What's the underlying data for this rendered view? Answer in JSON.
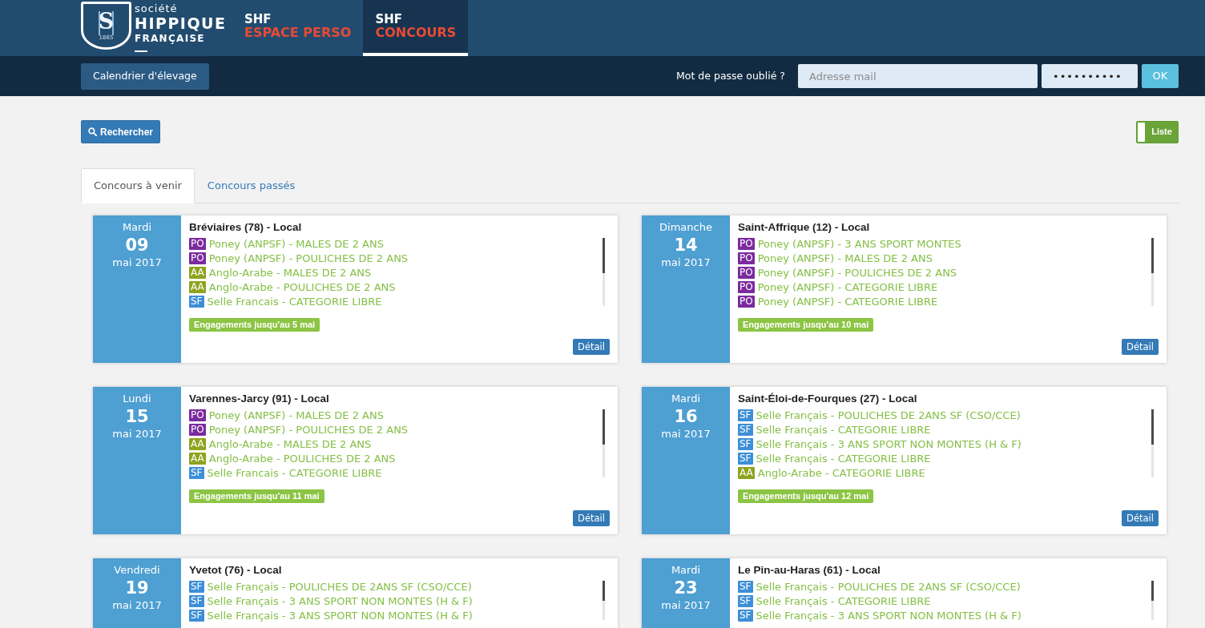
{
  "header": {
    "logo": {
      "monogram": "S",
      "year": "1865",
      "line_1": "société",
      "line_2": "HIPPIQUE",
      "line_3": "FRANÇAISE"
    },
    "nav": [
      {
        "line_1": "SHF",
        "line_2": "ESPACE PERSO",
        "selected": false
      },
      {
        "line_1": "SHF",
        "line_2": "CONCOURS",
        "selected": true
      }
    ]
  },
  "toolbar": {
    "calendar_button": "Calendrier d'élevage",
    "forgot_password": "Mot de passe oublié ?",
    "email": {
      "placeholder": "Adresse mail"
    },
    "password": {
      "value": "••••••••••"
    },
    "ok_button": "OK"
  },
  "search_button": "Rechercher",
  "view_toggle": {
    "label": "Liste",
    "on": true
  },
  "tabs": [
    {
      "label": "Concours à venir",
      "selected": true
    },
    {
      "label": "Concours passés",
      "selected": false
    }
  ],
  "events": [
    {
      "weekday": "Mardi",
      "day": "09",
      "month_year": "mai 2017",
      "title": "Bréviaires (78) - Local",
      "classes": [
        {
          "code": "PO",
          "color": "#7b2a9e",
          "label": "Poney (ANPSF) - MALES DE 2 ANS"
        },
        {
          "code": "PO",
          "color": "#7b2a9e",
          "label": "Poney (ANPSF) - POULICHES DE 2 ANS"
        },
        {
          "code": "AA",
          "color": "#8fa31f",
          "label": "Anglo-Arabe - MALES DE 2 ANS"
        },
        {
          "code": "AA",
          "color": "#8fa31f",
          "label": "Anglo-Arabe - POULICHES DE 2 ANS"
        },
        {
          "code": "SF",
          "color": "#3d8fd8",
          "label": "Selle Francais - CATEGORIE LIBRE"
        }
      ],
      "deadline": "Engagements jusqu'au 5 mai",
      "detail_button": "Détail"
    },
    {
      "weekday": "Dimanche",
      "day": "14",
      "month_year": "mai 2017",
      "title": "Saint-Affrique (12) - Local",
      "classes": [
        {
          "code": "PO",
          "color": "#7b2a9e",
          "label": "Poney (ANPSF) - 3 ANS SPORT MONTES"
        },
        {
          "code": "PO",
          "color": "#7b2a9e",
          "label": "Poney (ANPSF) - MALES DE 2 ANS"
        },
        {
          "code": "PO",
          "color": "#7b2a9e",
          "label": "Poney (ANPSF) - POULICHES DE 2 ANS"
        },
        {
          "code": "PO",
          "color": "#7b2a9e",
          "label": "Poney (ANPSF) - CATEGORIE LIBRE"
        },
        {
          "code": "PO",
          "color": "#7b2a9e",
          "label": "Poney (ANPSF) - CATEGORIE LIBRE"
        }
      ],
      "deadline": "Engagements jusqu'au 10 mai",
      "detail_button": "Détail"
    },
    {
      "weekday": "Lundi",
      "day": "15",
      "month_year": "mai 2017",
      "title": "Varennes-Jarcy (91) - Local",
      "classes": [
        {
          "code": "PO",
          "color": "#7b2a9e",
          "label": "Poney (ANPSF) - MALES DE 2 ANS"
        },
        {
          "code": "PO",
          "color": "#7b2a9e",
          "label": "Poney (ANPSF) - POULICHES DE 2 ANS"
        },
        {
          "code": "AA",
          "color": "#8fa31f",
          "label": "Anglo-Arabe - MALES DE 2 ANS"
        },
        {
          "code": "AA",
          "color": "#8fa31f",
          "label": "Anglo-Arabe - POULICHES DE 2 ANS"
        },
        {
          "code": "SF",
          "color": "#3d8fd8",
          "label": "Selle Francais - CATEGORIE LIBRE"
        }
      ],
      "deadline": "Engagements jusqu'au 11 mai",
      "detail_button": "Détail"
    },
    {
      "weekday": "Mardi",
      "day": "16",
      "month_year": "mai 2017",
      "title": "Saint-Éloi-de-Fourques (27) - Local",
      "classes": [
        {
          "code": "SF",
          "color": "#3d8fd8",
          "label": "Selle Français - POULICHES DE 2ANS SF (CSO/CCE)"
        },
        {
          "code": "SF",
          "color": "#3d8fd8",
          "label": "Selle Français - CATEGORIE LIBRE"
        },
        {
          "code": "SF",
          "color": "#3d8fd8",
          "label": "Selle Français - 3 ANS SPORT NON MONTES (H & F)"
        },
        {
          "code": "SF",
          "color": "#3d8fd8",
          "label": "Selle Français - CATEGORIE LIBRE"
        },
        {
          "code": "AA",
          "color": "#8fa31f",
          "label": "Anglo-Arabe - CATEGORIE LIBRE"
        }
      ],
      "deadline": "Engagements jusqu'au 12 mai",
      "detail_button": "Détail"
    },
    {
      "weekday": "Vendredi",
      "day": "19",
      "month_year": "mai 2017",
      "title": "Yvetot (76) - Local",
      "classes": [
        {
          "code": "SF",
          "color": "#3d8fd8",
          "label": "Selle Français - POULICHES DE 2ANS SF (CSO/CCE)"
        },
        {
          "code": "SF",
          "color": "#3d8fd8",
          "label": "Selle Français - 3 ANS SPORT NON MONTES (H & F)"
        },
        {
          "code": "SF",
          "color": "#3d8fd8",
          "label": "Selle Français - 3 ANS SPORT NON MONTES (H & F)"
        }
      ]
    },
    {
      "weekday": "Mardi",
      "day": "23",
      "month_year": "mai 2017",
      "title": "Le Pin-au-Haras (61) - Local",
      "classes": [
        {
          "code": "SF",
          "color": "#3d8fd8",
          "label": "Selle Français - POULICHES DE 2ANS SF (CSO/CCE)"
        },
        {
          "code": "SF",
          "color": "#3d8fd8",
          "label": "Selle Français - CATEGORIE LIBRE"
        },
        {
          "code": "SF",
          "color": "#3d8fd8",
          "label": "Selle Français - 3 ANS SPORT NON MONTES (H & F)"
        }
      ]
    }
  ]
}
